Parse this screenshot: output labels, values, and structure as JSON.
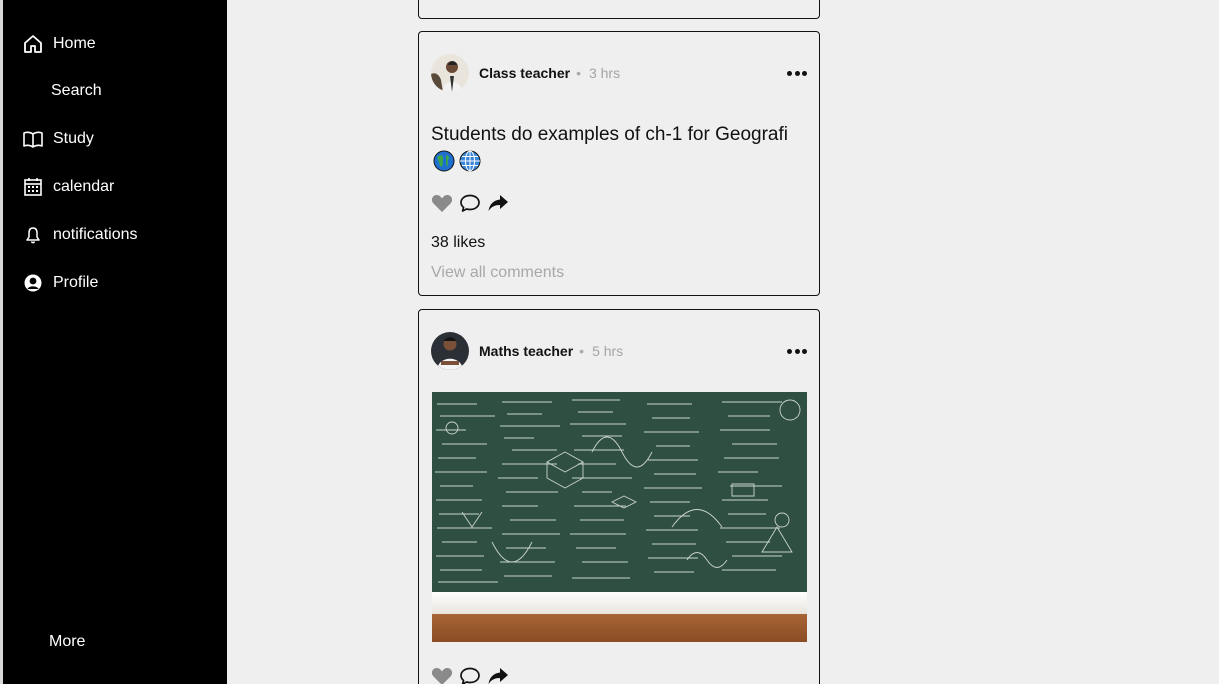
{
  "sidebar": {
    "items": [
      {
        "label": "Home",
        "icon": "home-icon"
      },
      {
        "label": "Search",
        "icon": "search-icon"
      },
      {
        "label": "Study",
        "icon": "book-icon"
      },
      {
        "label": "calendar",
        "icon": "calendar-icon"
      },
      {
        "label": "notifications",
        "icon": "bell-icon"
      },
      {
        "label": "Profile",
        "icon": "profile-icon"
      }
    ],
    "more_label": "More"
  },
  "posts": [
    {
      "author": "Class teacher",
      "separator": "•",
      "time": "3 hrs",
      "caption": "Students do examples of ch-1 for Geografi",
      "emojis": [
        "globe-americas-emoji",
        "globe-meridians-emoji"
      ],
      "likes": "38 likes",
      "comments_link": "View all comments"
    },
    {
      "author": "Maths teacher",
      "separator": "•",
      "time": "5 hrs",
      "image": "chalkboard-math-formulas"
    }
  ],
  "colors": {
    "sidebar_bg": "#000000",
    "page_bg": "#efefef",
    "heart": "#8a8a8a",
    "muted_text": "#a8a8a8",
    "chalkboard": "#2f4f43",
    "wood": "#9b5a2f"
  }
}
